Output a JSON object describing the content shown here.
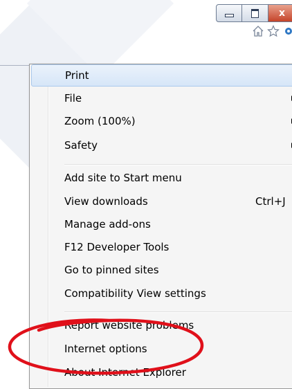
{
  "window_controls": {
    "minimize_icon": "minimize-icon",
    "maximize_icon": "maximize-icon",
    "close_label": "x"
  },
  "toolbar": {
    "icons": [
      "home-icon",
      "star-icon",
      "gear-icon"
    ]
  },
  "menu": {
    "items": [
      {
        "label": "Print",
        "submenu": true,
        "highlighted": true
      },
      {
        "label": "File",
        "submenu": true
      },
      {
        "label": "Zoom (100%)",
        "submenu": true
      },
      {
        "label": "Safety",
        "submenu": true
      },
      {
        "label": "Add site to Start menu"
      },
      {
        "label": "View downloads",
        "shortcut": "Ctrl+J"
      },
      {
        "label": "Manage add-ons"
      },
      {
        "label": "F12 Developer Tools"
      },
      {
        "label": "Go to pinned sites"
      },
      {
        "label": "Compatibility View settings"
      },
      {
        "label": "Report website problems"
      },
      {
        "label": "Internet options",
        "circled": true
      },
      {
        "label": "About Internet Explorer"
      }
    ]
  },
  "colors": {
    "highlight": "#d6e6f8",
    "annotation": "#e0101a",
    "close_button": "#c5432a"
  }
}
